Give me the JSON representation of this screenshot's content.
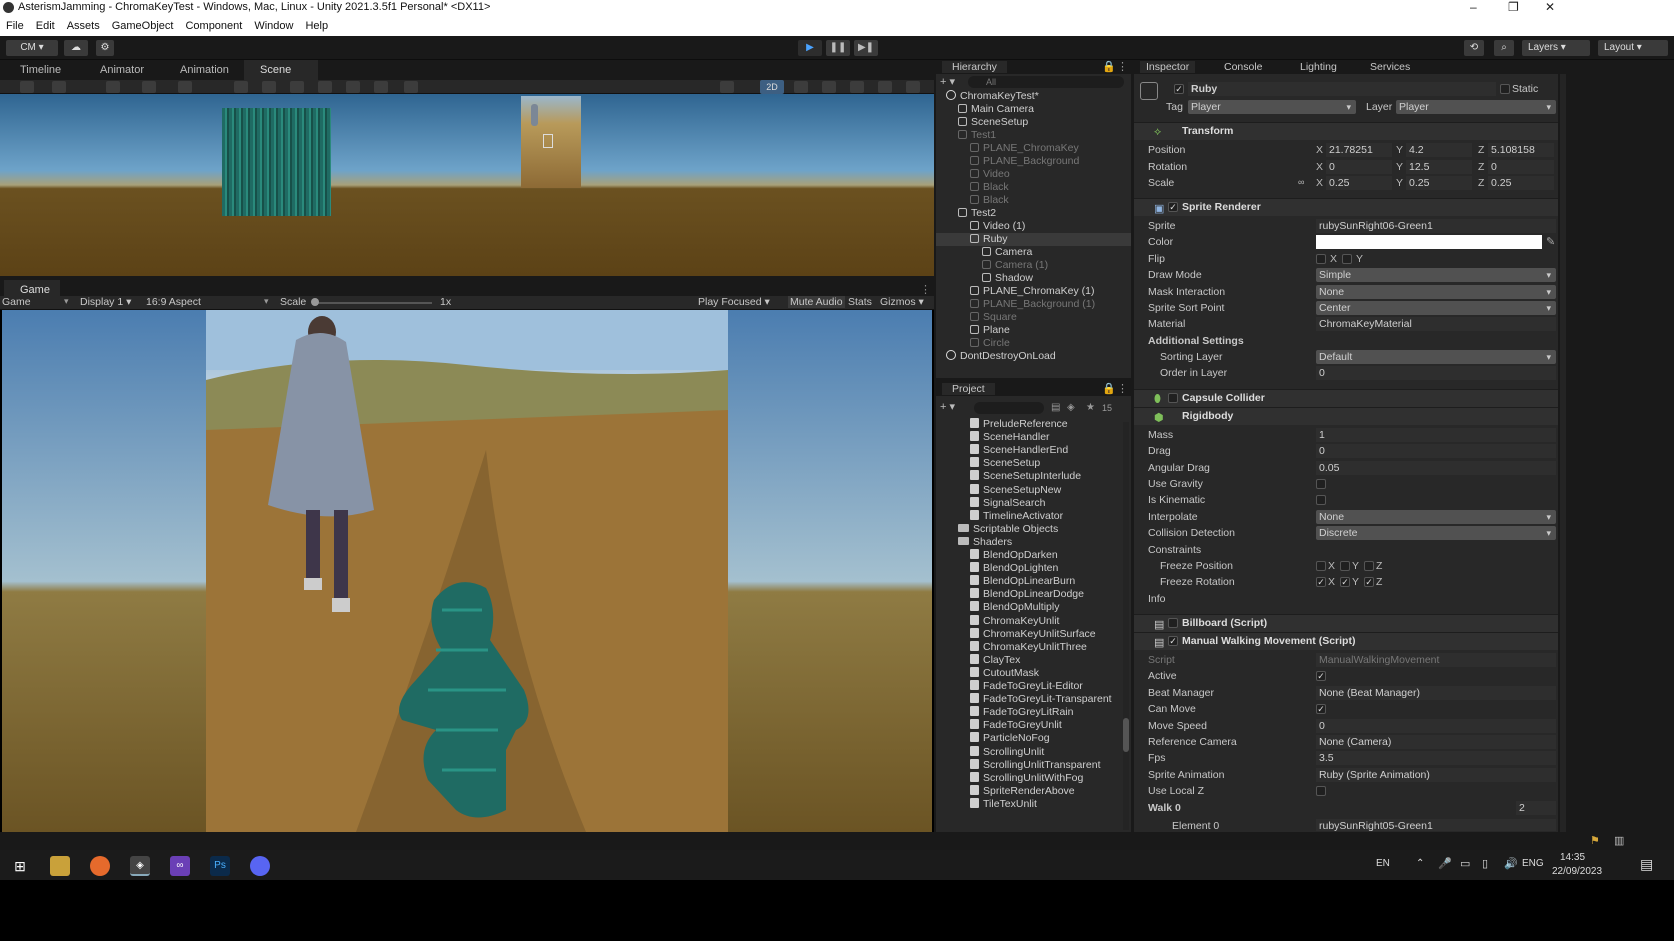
{
  "window": {
    "title": "AsterismJamming - ChromaKeyTest - Windows, Mac, Linux - Unity 2021.3.5f1 Personal* <DX11>",
    "minimize": "–",
    "maximize": "❐",
    "close": "✕"
  },
  "menu": [
    "File",
    "Edit",
    "Assets",
    "GameObject",
    "Component",
    "Window",
    "Help"
  ],
  "toolbar": {
    "account": "CM",
    "layers": "Layers",
    "layout": "Layout",
    "play": "▶",
    "pause": "❚❚",
    "step": "▶❚"
  },
  "top_tabs": [
    {
      "label": "Timeline"
    },
    {
      "label": "Animator"
    },
    {
      "label": "Animation"
    },
    {
      "label": "Scene"
    }
  ],
  "scene_toolbar": {
    "mode_2d": "2D"
  },
  "game_tab": {
    "label": "Game"
  },
  "game_bar": {
    "view": "Game",
    "display": "Display 1",
    "aspect": "16:9 Aspect",
    "scale_label": "Scale",
    "scale_value": "1x",
    "play_focused": "Play Focused",
    "mute": "Mute Audio",
    "stats": "Stats",
    "gizmos": "Gizmos"
  },
  "hierarchy": {
    "title": "Hierarchy",
    "search_placeholder": "All",
    "rows": [
      {
        "label": "ChromaKeyTest*",
        "indent": 0,
        "kind": "scene",
        "dim": false
      },
      {
        "label": "Main Camera",
        "indent": 1,
        "kind": "go",
        "dim": false
      },
      {
        "label": "SceneSetup",
        "indent": 1,
        "kind": "go",
        "dim": false
      },
      {
        "label": "Test1",
        "indent": 1,
        "kind": "go",
        "dim": true
      },
      {
        "label": "PLANE_ChromaKey",
        "indent": 2,
        "kind": "go",
        "dim": true
      },
      {
        "label": "PLANE_Background",
        "indent": 2,
        "kind": "go",
        "dim": true
      },
      {
        "label": "Video",
        "indent": 2,
        "kind": "go",
        "dim": true
      },
      {
        "label": "Black",
        "indent": 2,
        "kind": "go",
        "dim": true
      },
      {
        "label": "Black",
        "indent": 2,
        "kind": "go",
        "dim": true
      },
      {
        "label": "Test2",
        "indent": 1,
        "kind": "go",
        "dim": false
      },
      {
        "label": "Video (1)",
        "indent": 2,
        "kind": "go",
        "dim": false
      },
      {
        "label": "Ruby",
        "indent": 2,
        "kind": "go",
        "dim": false
      },
      {
        "label": "Camera",
        "indent": 3,
        "kind": "go",
        "dim": false
      },
      {
        "label": "Camera (1)",
        "indent": 3,
        "kind": "go",
        "dim": true
      },
      {
        "label": "Shadow",
        "indent": 3,
        "kind": "go",
        "dim": false
      },
      {
        "label": "PLANE_ChromaKey (1)",
        "indent": 2,
        "kind": "go",
        "dim": false
      },
      {
        "label": "PLANE_Background (1)",
        "indent": 2,
        "kind": "go",
        "dim": true
      },
      {
        "label": "Square",
        "indent": 2,
        "kind": "go",
        "dim": true
      },
      {
        "label": "Plane",
        "indent": 2,
        "kind": "go",
        "dim": false
      },
      {
        "label": "Circle",
        "indent": 2,
        "kind": "go",
        "dim": true
      },
      {
        "label": "DontDestroyOnLoad",
        "indent": 0,
        "kind": "scene",
        "dim": false
      }
    ]
  },
  "project": {
    "title": "Project",
    "count": "15",
    "rows": [
      {
        "label": "PreludeReference",
        "indent": 2,
        "kind": "script"
      },
      {
        "label": "SceneHandler",
        "indent": 2,
        "kind": "script"
      },
      {
        "label": "SceneHandlerEnd",
        "indent": 2,
        "kind": "script"
      },
      {
        "label": "SceneSetup",
        "indent": 2,
        "kind": "script"
      },
      {
        "label": "SceneSetupInterlude",
        "indent": 2,
        "kind": "script"
      },
      {
        "label": "SceneSetupNew",
        "indent": 2,
        "kind": "script"
      },
      {
        "label": "SignalSearch",
        "indent": 2,
        "kind": "script"
      },
      {
        "label": "TimelineActivator",
        "indent": 2,
        "kind": "script"
      },
      {
        "label": "Scriptable Objects",
        "indent": 1,
        "kind": "folder"
      },
      {
        "label": "Shaders",
        "indent": 1,
        "kind": "folder"
      },
      {
        "label": "BlendOpDarken",
        "indent": 2,
        "kind": "script"
      },
      {
        "label": "BlendOpLighten",
        "indent": 2,
        "kind": "script"
      },
      {
        "label": "BlendOpLinearBurn",
        "indent": 2,
        "kind": "script"
      },
      {
        "label": "BlendOpLinearDodge",
        "indent": 2,
        "kind": "script"
      },
      {
        "label": "BlendOpMultiply",
        "indent": 2,
        "kind": "script"
      },
      {
        "label": "ChromaKeyUnlit",
        "indent": 2,
        "kind": "script"
      },
      {
        "label": "ChromaKeyUnlitSurface",
        "indent": 2,
        "kind": "script"
      },
      {
        "label": "ChromaKeyUnlitThree",
        "indent": 2,
        "kind": "script"
      },
      {
        "label": "ClayTex",
        "indent": 2,
        "kind": "script"
      },
      {
        "label": "CutoutMask",
        "indent": 2,
        "kind": "script"
      },
      {
        "label": "FadeToGreyLit-Editor",
        "indent": 2,
        "kind": "script"
      },
      {
        "label": "FadeToGreyLit-Transparent",
        "indent": 2,
        "kind": "script"
      },
      {
        "label": "FadeToGreyLitRain",
        "indent": 2,
        "kind": "script"
      },
      {
        "label": "FadeToGreyUnlit",
        "indent": 2,
        "kind": "script"
      },
      {
        "label": "ParticleNoFog",
        "indent": 2,
        "kind": "script"
      },
      {
        "label": "ScrollingUnlit",
        "indent": 2,
        "kind": "script"
      },
      {
        "label": "ScrollingUnlitTransparent",
        "indent": 2,
        "kind": "script"
      },
      {
        "label": "ScrollingUnlitWithFog",
        "indent": 2,
        "kind": "script"
      },
      {
        "label": "SpriteRenderAbove",
        "indent": 2,
        "kind": "script"
      },
      {
        "label": "TileTexUnlit",
        "indent": 2,
        "kind": "script"
      }
    ]
  },
  "inspector": {
    "tabs": [
      "Inspector",
      "Console",
      "Lighting",
      "Services"
    ],
    "object_name": "Ruby",
    "static": "Static",
    "tag_label": "Tag",
    "tag": "Player",
    "layer_label": "Layer",
    "layer": "Player",
    "transform": {
      "name": "Transform",
      "pos_label": "Position",
      "rot_label": "Rotation",
      "scale_label": "Scale",
      "position": [
        "21.78251",
        "4.2",
        "5.108158"
      ],
      "rotation": [
        "0",
        "12.5",
        "0"
      ],
      "scale": [
        "0.25",
        "0.25",
        "0.25"
      ]
    },
    "sprite_renderer": {
      "name": "Sprite Renderer",
      "sprite_label": "Sprite",
      "sprite": "rubySunRight06-Green1",
      "color_label": "Color",
      "flip_label": "Flip",
      "flip_x": "X",
      "flip_y": "Y",
      "draw_mode_label": "Draw Mode",
      "draw_mode": "Simple",
      "mask_label": "Mask Interaction",
      "mask": "None",
      "sort_point_label": "Sprite Sort Point",
      "sort_point": "Center",
      "material_label": "Material",
      "material": "ChromaKeyMaterial",
      "additional": "Additional Settings",
      "sorting_layer_label": "Sorting Layer",
      "sorting_layer": "Default",
      "order_label": "Order in Layer",
      "order": "0"
    },
    "capsule": {
      "name": "Capsule Collider"
    },
    "rigidbody": {
      "name": "Rigidbody",
      "mass_label": "Mass",
      "mass": "1",
      "drag_label": "Drag",
      "drag": "0",
      "angdrag_label": "Angular Drag",
      "angdrag": "0.05",
      "gravity_label": "Use Gravity",
      "kinematic_label": "Is Kinematic",
      "interp_label": "Interpolate",
      "interp": "None",
      "coll_label": "Collision Detection",
      "coll": "Discrete",
      "constraints": "Constraints",
      "freeze_pos": "Freeze Position",
      "freeze_rot": "Freeze Rotation",
      "info": "Info"
    },
    "billboard": {
      "name": "Billboard (Script)"
    },
    "walking": {
      "name": "Manual Walking Movement (Script)",
      "script_label": "Script",
      "script": "ManualWalkingMovement",
      "active_label": "Active",
      "beat_label": "Beat Manager",
      "beat": "None (Beat Manager)",
      "canmove_label": "Can Move",
      "speed_label": "Move Speed",
      "speed": "0",
      "refcam_label": "Reference Camera",
      "refcam": "None (Camera)",
      "fps_label": "Fps",
      "fps": "3.5",
      "anim_label": "Sprite Animation",
      "anim": "Ruby (Sprite Animation)",
      "local_label": "Use Local Z",
      "walk_label": "Walk 0",
      "walk_count": "2",
      "element_label": "Element 0",
      "element": "rubySunRight05-Green1"
    }
  },
  "taskbar": {
    "lang": "EN",
    "ime": "ENG",
    "time": "14:35",
    "date": "22/09/2023"
  },
  "colors": {
    "accent": "#4aa3ff",
    "panel": "#282828",
    "teal": "#1f6b63"
  }
}
